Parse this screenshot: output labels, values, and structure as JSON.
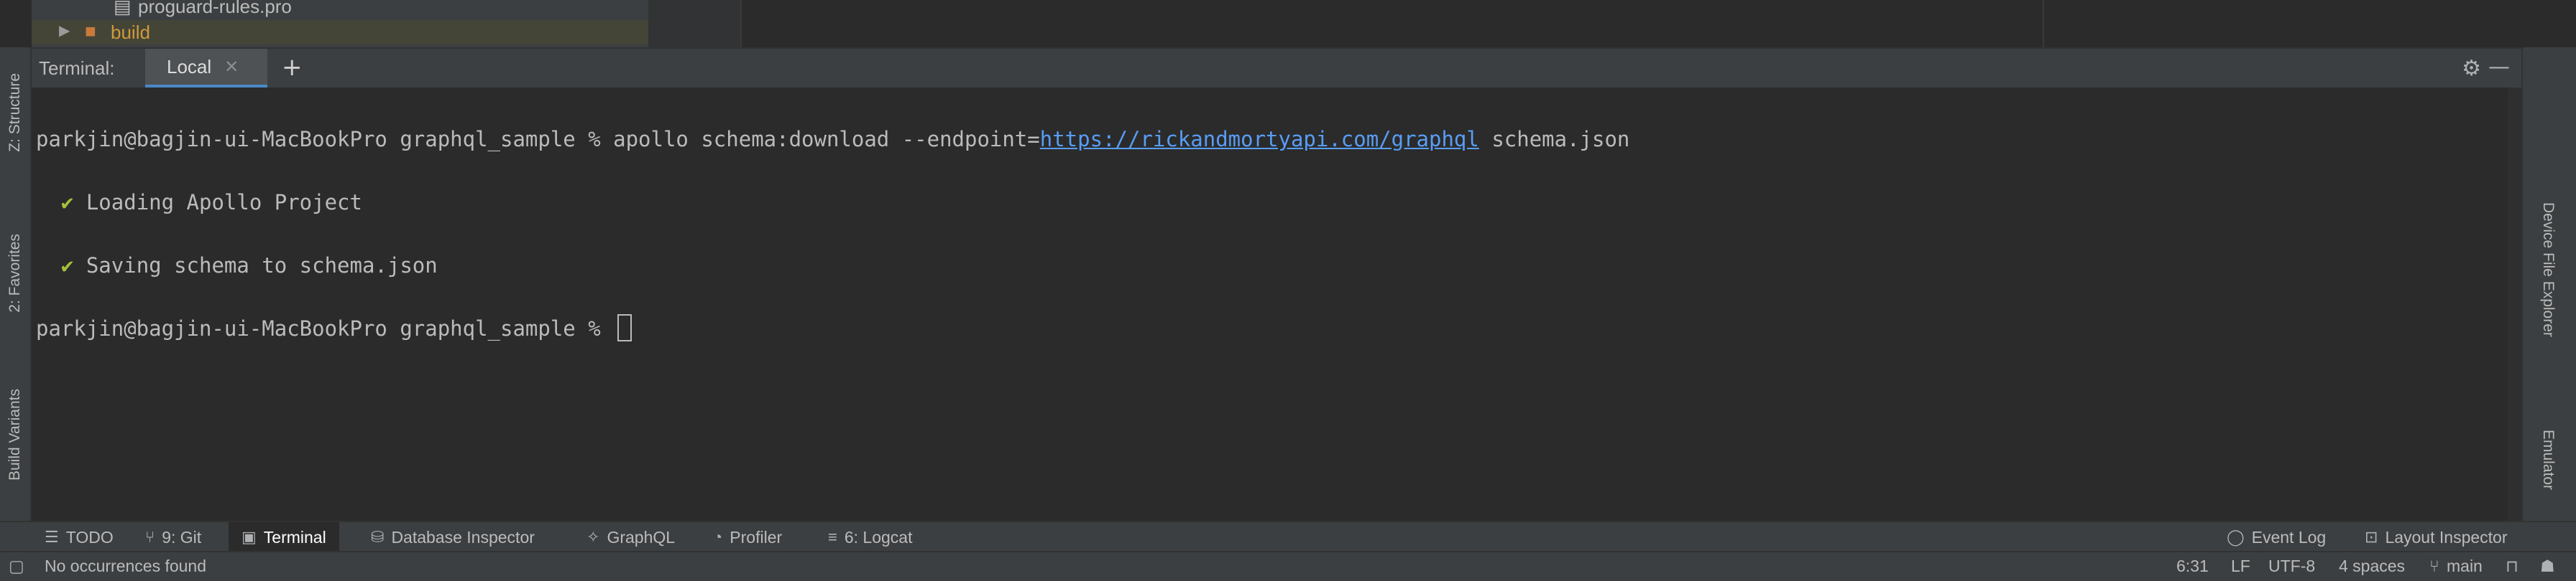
{
  "project_tree": {
    "file_item": "proguard-rules.pro",
    "folder_item": "build"
  },
  "left_stripe": {
    "structure": "Z: Structure",
    "favorites": "2: Favorites",
    "build_variants": "Build Variants"
  },
  "right_stripe": {
    "device_file_explorer": "Device File Explorer",
    "emulator": "Emulator"
  },
  "terminal": {
    "title": "Terminal:",
    "tab_label": "Local",
    "add_tab": "+",
    "lines": {
      "l1_prompt": "parkjin@bagjin-ui-MacBookPro graphql_sample % apollo schema:download --endpoint=",
      "l1_link": "https://rickandmortyapi.com/graphql",
      "l1_tail": " schema.json",
      "l2_check": "✔",
      "l2_text": " Loading Apollo Project",
      "l3_check": "✔",
      "l3_text": " Saving schema to schema.json",
      "l4_prompt": "parkjin@bagjin-ui-MacBookPro graphql_sample % "
    }
  },
  "tool_windows": {
    "todo": "TODO",
    "git": "9: Git",
    "terminal": "Terminal",
    "database_inspector": "Database Inspector",
    "graphql": "GraphQL",
    "profiler": "Profiler",
    "logcat": "6: Logcat",
    "event_log": "Event Log",
    "layout_inspector": "Layout Inspector"
  },
  "status_bar": {
    "message": "No occurrences found",
    "position": "6:31",
    "line_sep": "LF",
    "encoding": "UTF-8",
    "indent": "4 spaces",
    "branch": "main"
  },
  "colors": {
    "accent": "#4a88c7",
    "link": "#589df6",
    "check": "#a4c13a"
  }
}
